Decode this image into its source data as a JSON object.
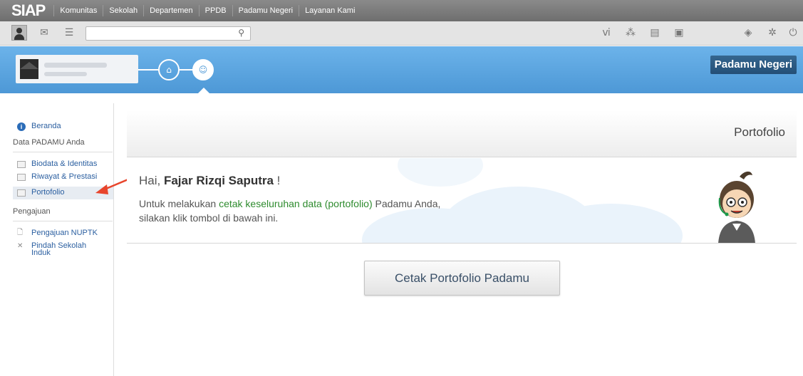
{
  "topnav": {
    "logo": "SIAP",
    "items": [
      "Komunitas",
      "Sekolah",
      "Departemen",
      "PPDB",
      "Padamu Negeri",
      "Layanan Kami"
    ]
  },
  "toolbar": {
    "search_placeholder": "",
    "icons": [
      "user-icon",
      "mail-icon",
      "list-icon",
      "rss-icon",
      "grid-icon",
      "calendar-icon",
      "contact-icon",
      "box-icon",
      "gear-icon",
      "power-icon"
    ]
  },
  "banner": {
    "brand": "Padamu Negeri"
  },
  "sidebar": {
    "home": "Beranda",
    "section1": "Data PADAMU Anda",
    "items1": [
      "Biodata & Identitas",
      "Riwayat & Prestasi",
      "Portofolio"
    ],
    "section2": "Pengajuan",
    "items2": [
      "Pengajuan NUPTK",
      "Pindah Sekolah Induk"
    ]
  },
  "main": {
    "title": "Portofolio",
    "greeting_prefix": "Hai, ",
    "greeting_name": "Fajar Rizqi Saputra",
    "greeting_suffix": " !",
    "msg_before": "Untuk melakukan ",
    "msg_highlight": "cetak keseluruhan data (portofolio)",
    "msg_after": " Padamu Anda,",
    "msg_line2": "silakan klik tombol di bawah ini.",
    "print_button": "Cetak Portofolio Padamu"
  },
  "colors": {
    "banner": "#5fa7e0",
    "brand_box": "#2a5b86",
    "link": "#2b5fa0",
    "highlight": "#2e8b2e",
    "arrow": "#e8452c"
  }
}
